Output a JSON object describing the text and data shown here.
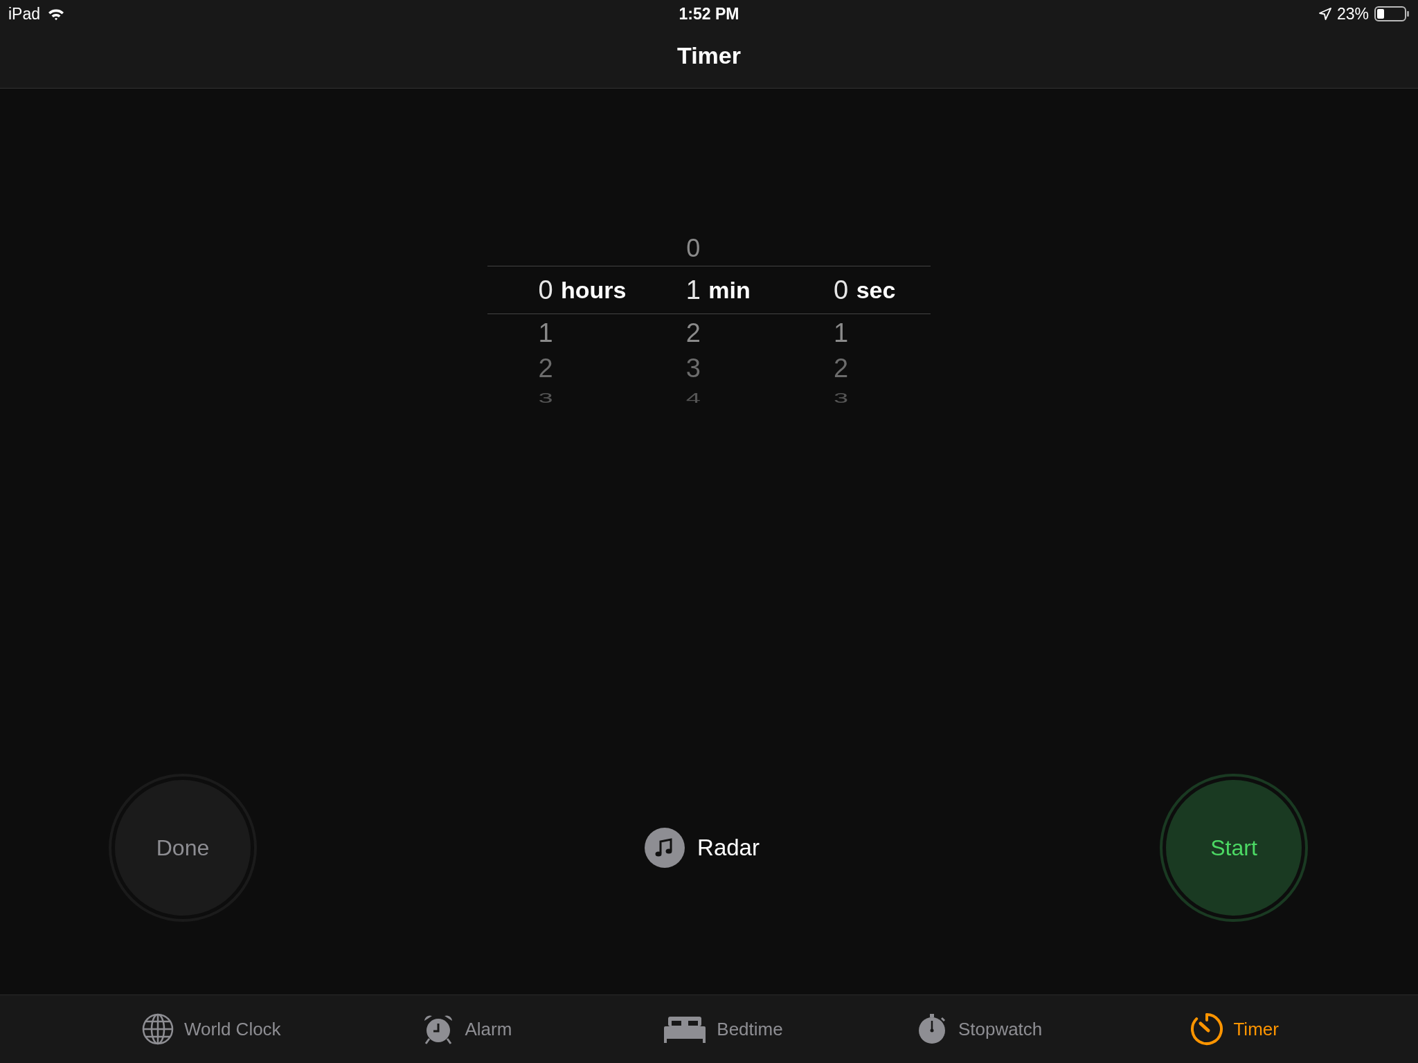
{
  "status_bar": {
    "device": "iPad",
    "time": "1:52 PM",
    "battery": "23%"
  },
  "nav": {
    "title": "Timer"
  },
  "picker": {
    "columns": [
      {
        "value": "0",
        "unit": "hours",
        "below": [
          "1",
          "2",
          "3"
        ]
      },
      {
        "above": [
          "0"
        ],
        "value": "1",
        "unit": "min",
        "below": [
          "2",
          "3",
          "4"
        ]
      },
      {
        "value": "0",
        "unit": "sec",
        "below": [
          "1",
          "2",
          "3"
        ]
      }
    ]
  },
  "controls": {
    "left": {
      "label": "Done",
      "kind": "neutral"
    },
    "sound": {
      "label": "Radar"
    },
    "right": {
      "label": "Start",
      "kind": "start"
    }
  },
  "tabs": [
    {
      "label": "World Clock",
      "kind": "globe",
      "selected": false
    },
    {
      "label": "Alarm",
      "kind": "alarm",
      "selected": false
    },
    {
      "label": "Bedtime",
      "kind": "bed",
      "selected": false
    },
    {
      "label": "Stopwatch",
      "kind": "stopwatch",
      "selected": false
    },
    {
      "label": "Timer",
      "kind": "timer",
      "selected": true
    }
  ]
}
